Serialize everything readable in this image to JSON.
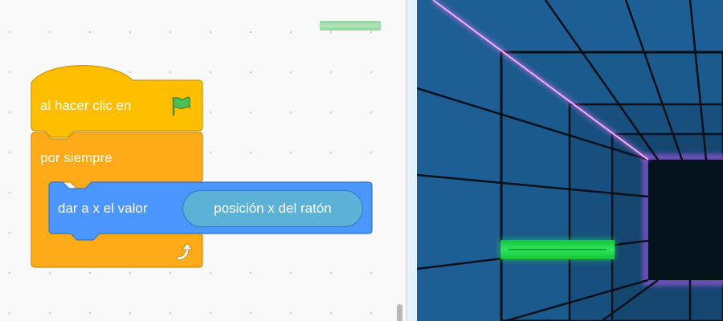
{
  "workspace": {
    "blocks": {
      "event": {
        "label": "al hacer clic en",
        "icon": "green-flag-icon",
        "color": "#ffbf00",
        "border": "#cc9900"
      },
      "forever": {
        "label": "por siempre",
        "icon": "repeat-arrow-icon",
        "color": "#ffab19",
        "border": "#cf8b17"
      },
      "motion": {
        "label": "dar a x el valor",
        "color": "#4c97ff",
        "border": "#3373cc"
      },
      "reporter": {
        "label": "posición x del ratón",
        "color": "#5cb1d6",
        "border": "#3373cc"
      }
    }
  },
  "stage": {
    "background_color": "#1d5f94",
    "accent_line_color": "#e070ff",
    "paddle_color": "#22dd4a"
  }
}
